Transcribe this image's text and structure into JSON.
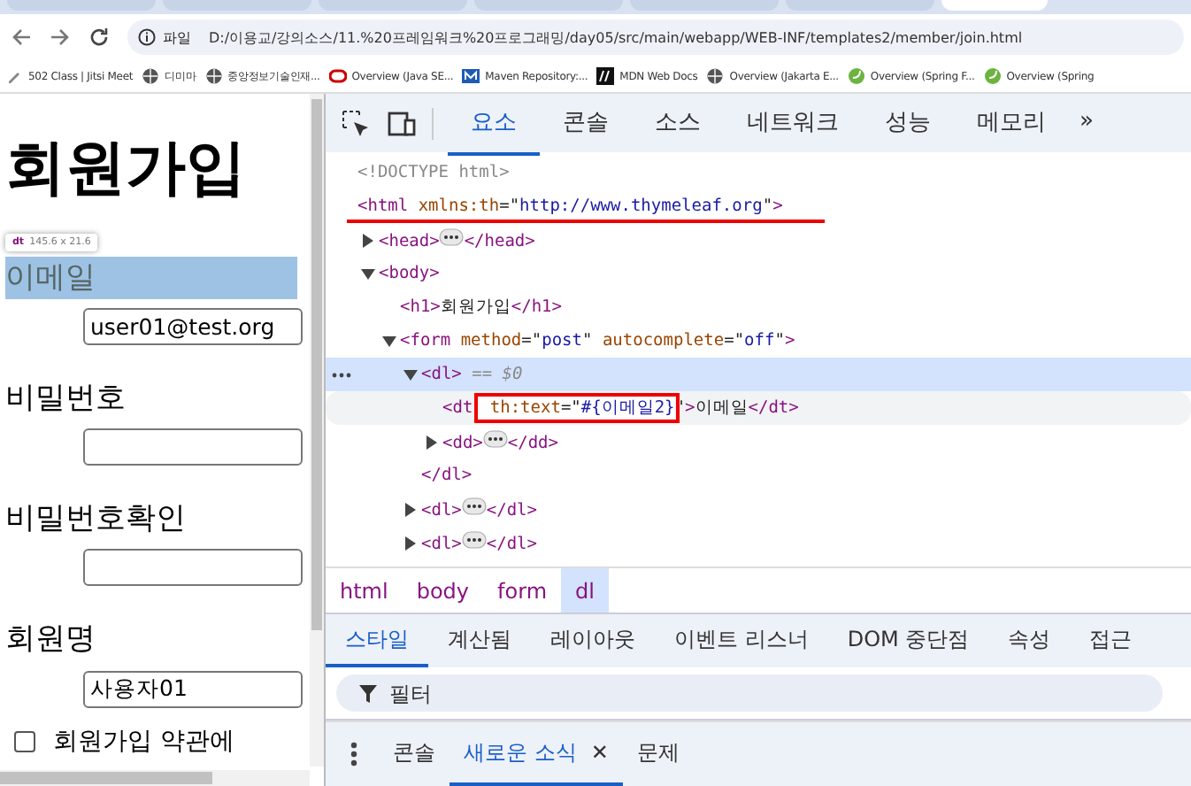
{
  "browser": {
    "tabs": [
      {
        "selected": false
      },
      {
        "selected": false
      },
      {
        "selected": false
      },
      {
        "selected": false
      },
      {
        "selected": false
      },
      {
        "selected": false
      },
      {
        "selected": true
      }
    ],
    "address": {
      "scheme_label": "파일",
      "url": "D:/이용교/강의소스/11.%20프레임워크%20프로그래밍/day05/src/main/webapp/WEB-INF/templates2/member/join.html"
    },
    "bookmarks": [
      {
        "label": "502 Class | Jitsi Meet",
        "kind": "pen"
      },
      {
        "label": "디미마",
        "kind": "globe"
      },
      {
        "label": "중앙정보기술인재...",
        "kind": "globe"
      },
      {
        "label": "Overview (Java SE...",
        "kind": "oracle"
      },
      {
        "label": "Maven Repository:...",
        "kind": "maven"
      },
      {
        "label": "MDN Web Docs",
        "kind": "mdn"
      },
      {
        "label": "Overview (Jakarta E...",
        "kind": "globe"
      },
      {
        "label": "Overview (Spring F...",
        "kind": "spring"
      },
      {
        "label": "Overview (Spring",
        "kind": "spring"
      }
    ]
  },
  "page": {
    "heading": "회원가입",
    "inspect_tooltip": {
      "tag": "dt",
      "size": "145.6 x 21.6"
    },
    "fields": [
      {
        "label": "이메일",
        "value": "user01@test.org",
        "highlighted": true
      },
      {
        "label": "비밀번호",
        "highlighted": false
      },
      {
        "label": "비밀번호확인",
        "highlighted": false
      },
      {
        "label": "회원명",
        "value": "사용자01",
        "highlighted": false
      }
    ],
    "agreement": {
      "label": "회원가입 약관에",
      "checked": false
    }
  },
  "devtools": {
    "panel_tabs": [
      {
        "label": "요소",
        "selected": true
      },
      {
        "label": "콘솔",
        "selected": false
      },
      {
        "label": "소스",
        "selected": false
      },
      {
        "label": "네트워크",
        "selected": false
      },
      {
        "label": "성능",
        "selected": false
      },
      {
        "label": "메모리",
        "selected": false
      }
    ],
    "more_tabs": "»",
    "dom_tree": [
      {
        "tokens": [
          {
            "kind": "doctype",
            "s": "<!DOCTYPE html>"
          }
        ]
      },
      {
        "tokens": [
          {
            "kind": "tag",
            "s": "<html"
          },
          {
            "kind": "attr",
            "s": " xmlns:th"
          },
          {
            "kind": "plain",
            "s": "=\""
          },
          {
            "kind": "val",
            "s": "http://www.thymeleaf.org"
          },
          {
            "kind": "plain",
            "s": "\""
          },
          {
            "kind": "tag",
            "s": ">"
          }
        ],
        "underlined": true,
        "children": [
          {
            "tokens": [
              {
                "kind": "tag",
                "s": "<head>"
              },
              {
                "kind": "ellipsis"
              },
              {
                "kind": "tag",
                "s": "</head>"
              }
            ],
            "expanded": false
          },
          {
            "tokens": [
              {
                "kind": "tag",
                "s": "<body>"
              }
            ],
            "expanded": true,
            "children": [
              {
                "tokens": [
                  {
                    "kind": "tag",
                    "s": "<h1>"
                  },
                  {
                    "kind": "plain",
                    "s": "회원가입"
                  },
                  {
                    "kind": "tag",
                    "s": "</h1>"
                  }
                ]
              },
              {
                "tokens": [
                  {
                    "kind": "tag",
                    "s": "<form"
                  },
                  {
                    "kind": "attr",
                    "s": " method"
                  },
                  {
                    "kind": "plain",
                    "s": "=\""
                  },
                  {
                    "kind": "val",
                    "s": "post"
                  },
                  {
                    "kind": "plain",
                    "s": "\""
                  },
                  {
                    "kind": "attr",
                    "s": " autocomplete"
                  },
                  {
                    "kind": "plain",
                    "s": "=\""
                  },
                  {
                    "kind": "val",
                    "s": "off"
                  },
                  {
                    "kind": "plain",
                    "s": "\""
                  },
                  {
                    "kind": "tag",
                    "s": ">"
                  }
                ],
                "expanded": true,
                "children": [
                  {
                    "tokens": [
                      {
                        "kind": "tag",
                        "s": "<dl>"
                      },
                      {
                        "kind": "note",
                        "s": " == $0"
                      }
                    ],
                    "expanded": true,
                    "selected": true,
                    "closing": "</dl>",
                    "children": [
                      {
                        "tokens": [
                          {
                            "kind": "tag",
                            "s": "<dt"
                          },
                          {
                            "kind": "attr",
                            "s": " th:text",
                            "boxed": true
                          },
                          {
                            "kind": "plain",
                            "s": "=\"",
                            "boxed": true
                          },
                          {
                            "kind": "val",
                            "s": "#{이메일2}",
                            "boxed": true
                          },
                          {
                            "kind": "plain",
                            "s": "\""
                          },
                          {
                            "kind": "tag",
                            "s": ">"
                          },
                          {
                            "kind": "plain",
                            "s": "이메일"
                          },
                          {
                            "kind": "tag",
                            "s": "</dt>"
                          }
                        ],
                        "hovered": true
                      },
                      {
                        "tokens": [
                          {
                            "kind": "tag",
                            "s": "<dd>"
                          },
                          {
                            "kind": "ellipsis"
                          },
                          {
                            "kind": "tag",
                            "s": "</dd>"
                          }
                        ],
                        "expanded": false
                      }
                    ]
                  },
                  {
                    "tokens": [
                      {
                        "kind": "tag",
                        "s": "<dl>"
                      },
                      {
                        "kind": "ellipsis"
                      },
                      {
                        "kind": "tag",
                        "s": "</dl>"
                      }
                    ],
                    "expanded": false
                  },
                  {
                    "tokens": [
                      {
                        "kind": "tag",
                        "s": "<dl>"
                      },
                      {
                        "kind": "ellipsis"
                      },
                      {
                        "kind": "tag",
                        "s": "</dl>"
                      }
                    ],
                    "expanded": false
                  }
                ]
              }
            ]
          }
        ]
      }
    ],
    "breadcrumbs": [
      {
        "label": "html",
        "selected": false
      },
      {
        "label": "body",
        "selected": false
      },
      {
        "label": "form",
        "selected": false
      },
      {
        "label": "dl",
        "selected": true
      }
    ],
    "style_tabs": [
      {
        "label": "스타일",
        "selected": true
      },
      {
        "label": "계산됨",
        "selected": false
      },
      {
        "label": "레이아웃",
        "selected": false
      },
      {
        "label": "이벤트 리스너",
        "selected": false
      },
      {
        "label": "DOM 중단점",
        "selected": false
      },
      {
        "label": "속성",
        "selected": false
      },
      {
        "label": "접근",
        "selected": false
      }
    ],
    "filter": {
      "placeholder": "필터"
    },
    "drawer_tabs": [
      {
        "label": "콘솔",
        "selected": false,
        "closable": false
      },
      {
        "label": "새로운 소식",
        "selected": true,
        "closable": true
      },
      {
        "label": "문제",
        "selected": false,
        "closable": false
      }
    ],
    "close_symbol": "✕"
  }
}
